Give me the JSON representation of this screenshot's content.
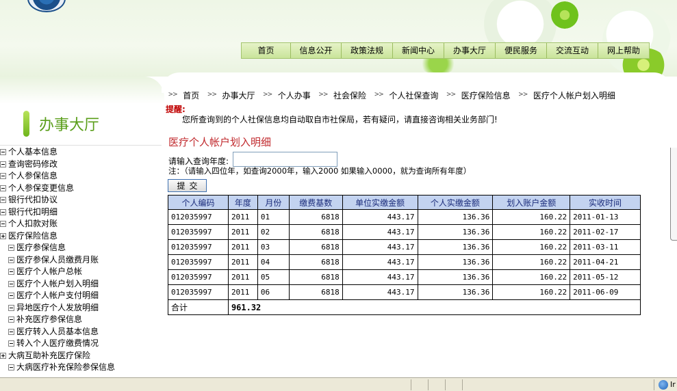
{
  "header": {
    "faded_title": "",
    "nav": [
      "首页",
      "信息公开",
      "政策法规",
      "新闻中心",
      "办事大厅",
      "便民服务",
      "交流互动",
      "网上帮助"
    ]
  },
  "sidebar": {
    "title": "办事大厅",
    "items": [
      {
        "label": "个人基本信息",
        "level": 0,
        "expand": "minus"
      },
      {
        "label": "查询密码修改",
        "level": 0,
        "expand": "minus"
      },
      {
        "label": "个人参保信息",
        "level": 0,
        "expand": "minus"
      },
      {
        "label": "个人参保变更信息",
        "level": 0,
        "expand": "minus"
      },
      {
        "label": "银行代扣协议",
        "level": 0,
        "expand": "minus"
      },
      {
        "label": "银行代扣明细",
        "level": 0,
        "expand": "minus"
      },
      {
        "label": "个人扣款对账",
        "level": 0,
        "expand": "minus"
      },
      {
        "label": "医疗保险信息",
        "level": 0,
        "expand": "plus"
      },
      {
        "label": "医疗参保信息",
        "level": 1,
        "expand": "minus"
      },
      {
        "label": "医疗参保人员缴费月账",
        "level": 1,
        "expand": "minus"
      },
      {
        "label": "医疗个人帐户总帐",
        "level": 1,
        "expand": "minus"
      },
      {
        "label": "医疗个人帐户划入明细",
        "level": 1,
        "expand": "minus"
      },
      {
        "label": "医疗个人帐户支付明细",
        "level": 1,
        "expand": "minus"
      },
      {
        "label": "异地医疗个人发放明细",
        "level": 1,
        "expand": "minus"
      },
      {
        "label": "补充医疗参保信息",
        "level": 1,
        "expand": "minus"
      },
      {
        "label": "医疗转入人员基本信息",
        "level": 1,
        "expand": "minus"
      },
      {
        "label": "转入个人医疗缴费情况",
        "level": 1,
        "expand": "minus"
      },
      {
        "label": "大病互助补充医疗保险",
        "level": 0,
        "expand": "plus"
      },
      {
        "label": "大病医疗补充保险参保信息",
        "level": 1,
        "expand": "minus"
      }
    ]
  },
  "breadcrumb": {
    "separator": ">>",
    "items": [
      "首页",
      "办事大厅",
      "个人办事",
      "社会保险",
      "个人社保查询",
      "医疗保险信息",
      "医疗个人帐户划入明细"
    ]
  },
  "reminder": {
    "label": "提醒:",
    "text": "您所查询到的个人社保信息均自动取自市社保局，若有疑问，请直接咨询相关业务部门!"
  },
  "page_title": "医疗个人帐户划入明细",
  "query": {
    "year_label": "请输入查询年度:",
    "year_value": "",
    "note": "注：（请输入四位年，如查询2000年，输入2000 如果输入0000，就为查询所有年度）",
    "submit_label": "提交"
  },
  "table": {
    "headers": [
      "个人编码",
      "年度",
      "月份",
      "缴费基数",
      "单位实缴金额",
      "个人实缴金额",
      "划入账户金额",
      "实收时间"
    ],
    "rows": [
      [
        "012035997",
        "2011",
        "01",
        "6818",
        "443.17",
        "136.36",
        "160.22",
        "2011-01-13"
      ],
      [
        "012035997",
        "2011",
        "02",
        "6818",
        "443.17",
        "136.36",
        "160.22",
        "2011-02-17"
      ],
      [
        "012035997",
        "2011",
        "03",
        "6818",
        "443.17",
        "136.36",
        "160.22",
        "2011-03-11"
      ],
      [
        "012035997",
        "2011",
        "04",
        "6818",
        "443.17",
        "136.36",
        "160.22",
        "2011-04-21"
      ],
      [
        "012035997",
        "2011",
        "05",
        "6818",
        "443.17",
        "136.36",
        "160.22",
        "2011-05-12"
      ],
      [
        "012035997",
        "2011",
        "06",
        "6818",
        "443.17",
        "136.36",
        "160.22",
        "2011-06-09"
      ]
    ],
    "total_label": "合计",
    "total_value": "961.32"
  },
  "statusbar": {
    "zone_text": "Ir"
  },
  "colors": {
    "title_red": "#c0282c",
    "header_bg": "#c3d3f0",
    "nav_green": "#c9e49a",
    "sidebar_title_green": "#5a9e1a"
  },
  "icons": {
    "logo": "logo-emblem",
    "tree_collapsed": "tree-plus-icon",
    "tree_expanded": "tree-minus-icon",
    "status_zone": "globe-icon"
  }
}
